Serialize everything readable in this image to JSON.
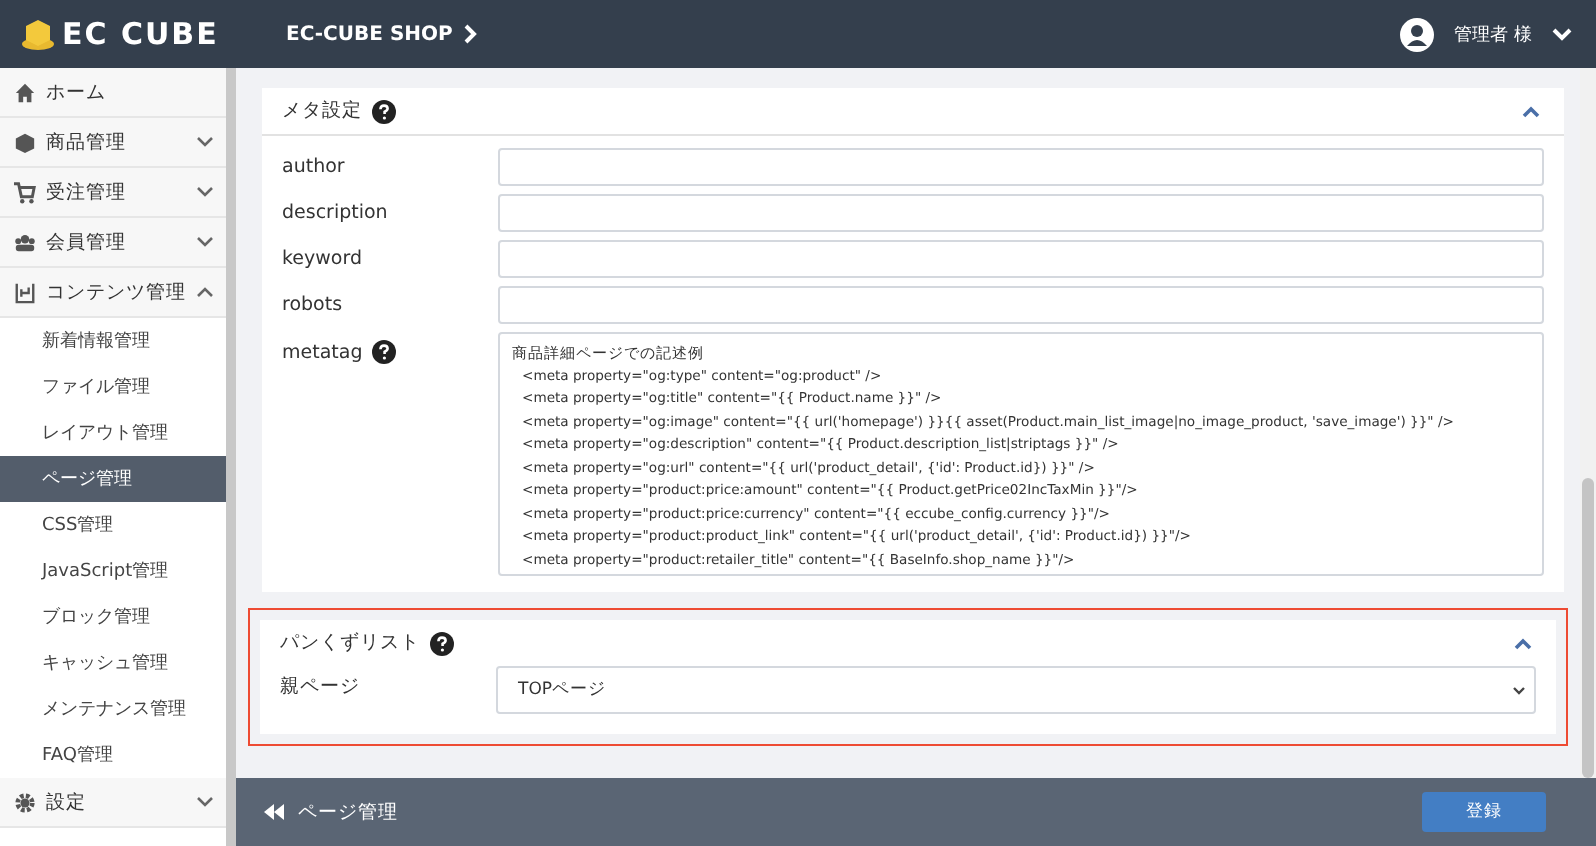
{
  "header": {
    "logo": "EC CUBE",
    "shop": "EC-CUBE SHOP",
    "user": "管理者 様"
  },
  "sidebar": {
    "items": [
      {
        "label": "ホーム",
        "kind": "link"
      },
      {
        "label": "商品管理",
        "kind": "group",
        "expanded": false
      },
      {
        "label": "受注管理",
        "kind": "group",
        "expanded": false
      },
      {
        "label": "会員管理",
        "kind": "group",
        "expanded": false
      },
      {
        "label": "コンテンツ管理",
        "kind": "group",
        "expanded": true,
        "children": [
          {
            "label": "新着情報管理",
            "selected": false
          },
          {
            "label": "ファイル管理",
            "selected": false
          },
          {
            "label": "レイアウト管理",
            "selected": false
          },
          {
            "label": "ページ管理",
            "selected": true
          },
          {
            "label": "CSS管理",
            "selected": false
          },
          {
            "label": "JavaScript管理",
            "selected": false
          },
          {
            "label": "ブロック管理",
            "selected": false
          },
          {
            "label": "キャッシュ管理",
            "selected": false
          },
          {
            "label": "メンテナンス管理",
            "selected": false
          },
          {
            "label": "FAQ管理",
            "selected": false
          }
        ]
      },
      {
        "label": "設定",
        "kind": "group",
        "expanded": false
      }
    ]
  },
  "meta_card": {
    "title": "メタ設定",
    "fields": [
      {
        "label": "author",
        "kind": "input",
        "help": false
      },
      {
        "label": "description",
        "kind": "input",
        "help": false
      },
      {
        "label": "keyword",
        "kind": "input",
        "help": false
      },
      {
        "label": "robots",
        "kind": "input",
        "help": false
      },
      {
        "label": "metatag",
        "kind": "textarea",
        "help": true,
        "lines": [
          "商品詳細ページでの記述例",
          "<meta property=\"og:type\" content=\"og:product\" />",
          "<meta property=\"og:title\" content=\"{{ Product.name }}\" />",
          "<meta property=\"og:image\" content=\"{{ url('homepage') }}{{ asset(Product.main_list_image|no_image_product, 'save_image') }}\" />",
          "<meta property=\"og:description\" content=\"{{ Product.description_list|striptags }}\" />",
          "<meta property=\"og:url\" content=\"{{ url('product_detail', {'id': Product.id}) }}\" />",
          "<meta property=\"product:price:amount\" content=\"{{ Product.getPrice02IncTaxMin }}\"/>",
          "<meta property=\"product:price:currency\" content=\"{{ eccube_config.currency }}\"/>",
          "<meta property=\"product:product_link\" content=\"{{ url('product_detail', {'id': Product.id}) }}\"/>",
          "<meta property=\"product:retailer_title\" content=\"{{ BaseInfo.shop_name }}\"/>"
        ]
      }
    ]
  },
  "breadcrumb_card": {
    "title": "パンくずリスト",
    "field_label": "親ページ",
    "select_value": "TOPページ",
    "expanded": true
  },
  "footer": {
    "back": "ページ管理",
    "submit": "登録"
  }
}
